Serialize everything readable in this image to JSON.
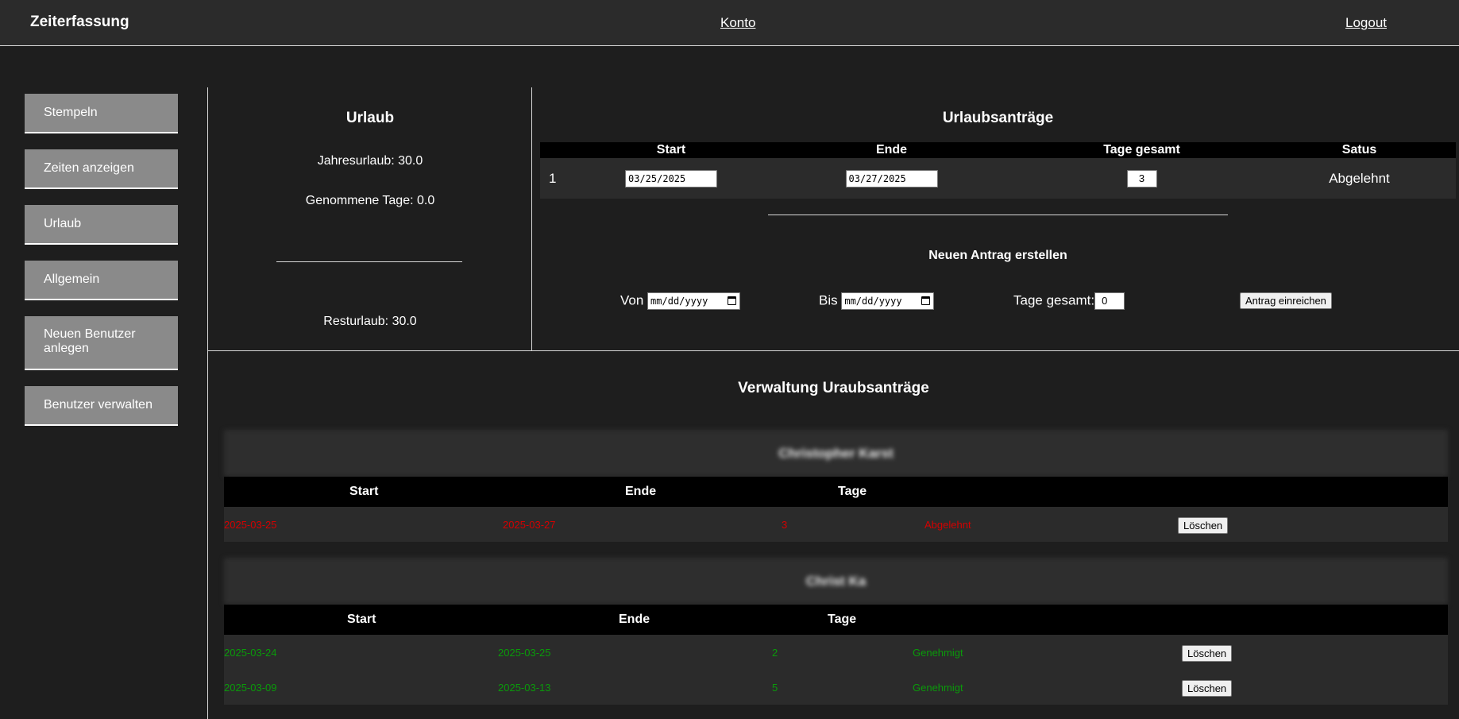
{
  "header": {
    "app_title": "Zeiterfassung",
    "konto": "Konto",
    "logout": "Logout"
  },
  "sidebar": {
    "items": [
      {
        "label": "Stempeln"
      },
      {
        "label": "Zeiten anzeigen"
      },
      {
        "label": "Urlaub"
      },
      {
        "label": "Allgemein"
      },
      {
        "label": "Neuen Benutzer anlegen"
      },
      {
        "label": "Benutzer verwalten"
      }
    ]
  },
  "urlaub": {
    "title": "Urlaub",
    "jahresurlaub": "Jahresurlaub: 30.0",
    "genommene": "Genommene Tage: 0.0",
    "resturlaub": "Resturlaub: 30.0"
  },
  "antraege": {
    "title": "Urlaubsanträge",
    "columns": {
      "start": "Start",
      "ende": "Ende",
      "tage": "Tage gesamt",
      "status": "Satus"
    },
    "rows": [
      {
        "nr": "1",
        "start": "03/25/2025",
        "ende": "03/27/2025",
        "tage": "3",
        "status": "Abgelehnt"
      }
    ],
    "new_title": "Neuen Antrag erstellen",
    "form": {
      "von_label": "Von",
      "von_placeholder": "mm/dd/yyyy",
      "bis_label": "Bis",
      "bis_placeholder": "mm/dd/yyyy",
      "tage_label": "Tage gesamt:",
      "tage_value": "0",
      "submit": "Antrag einreichen"
    }
  },
  "verwaltung": {
    "title": "Verwaltung Uraubsanträge",
    "delete_label": "Löschen",
    "groups": [
      {
        "user": "Christopher Karst",
        "columns": {
          "start": "Start",
          "ende": "Ende",
          "tage": "Tage"
        },
        "rows": [
          {
            "start": "2025-03-25",
            "ende": "2025-03-27",
            "tage": "3",
            "status": "Abgelehnt",
            "status_color": "#d40000"
          }
        ]
      },
      {
        "user": "Christ Ka",
        "columns": {
          "start": "Start",
          "ende": "Ende",
          "tage": "Tage"
        },
        "rows": [
          {
            "start": "2025-03-24",
            "ende": "2025-03-25",
            "tage": "2",
            "status": "Genehmigt",
            "status_color": "#0a9a0a"
          },
          {
            "start": "2025-03-09",
            "ende": "2025-03-13",
            "tage": "5",
            "status": "Genehmigt",
            "status_color": "#0a9a0a"
          }
        ]
      }
    ]
  },
  "colors": {
    "background": "#1e1e1e",
    "header": "#2b2b2b",
    "sidebar_button": "#8a8a8a",
    "table_header": "#000000",
    "rejected": "#d40000",
    "approved": "#0a9a0a"
  }
}
